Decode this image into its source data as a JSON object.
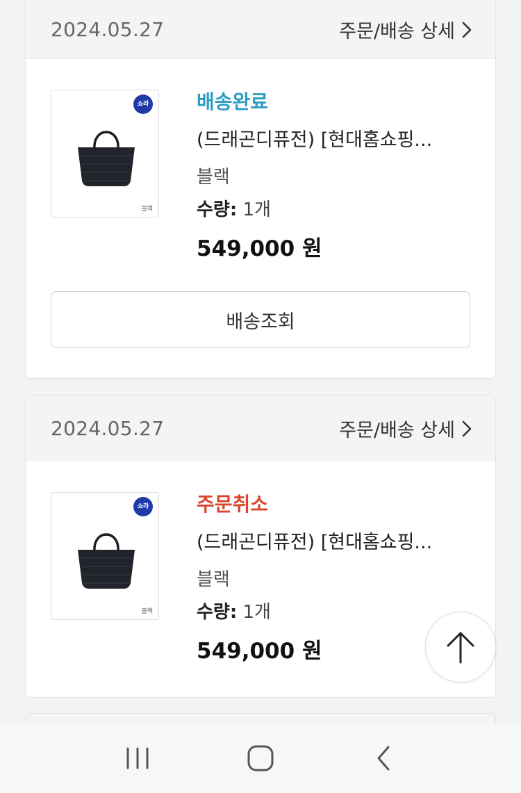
{
  "orders": [
    {
      "date": "2024.05.27",
      "detail_label": "주문/배송 상세",
      "status": "배송완료",
      "product_name": "(드래곤디퓨전) [현대홈쇼핑...",
      "option": "블랙",
      "qty_label": "수량:",
      "qty_value": " 1개",
      "price": "549,000 원",
      "badge_text": "쇼라",
      "thumb_caption": "블랙",
      "action_label": "배송조회"
    },
    {
      "date": "2024.05.27",
      "detail_label": "주문/배송 상세",
      "status": "주문취소",
      "product_name": "(드래곤디퓨전) [현대홈쇼핑...",
      "option": "블랙",
      "qty_label": "수량:",
      "qty_value": " 1개",
      "price": "549,000 원",
      "badge_text": "쇼라",
      "thumb_caption": "블랙"
    }
  ],
  "colors": {
    "status_delivered": "#2a9dc4",
    "status_cancelled": "#d9462c",
    "badge": "#1f3aa8"
  },
  "icons": {
    "detail": "chevron-right-icon",
    "scroll_top": "arrow-up-icon",
    "nav": [
      "recent-apps-icon",
      "home-icon",
      "back-icon"
    ]
  }
}
